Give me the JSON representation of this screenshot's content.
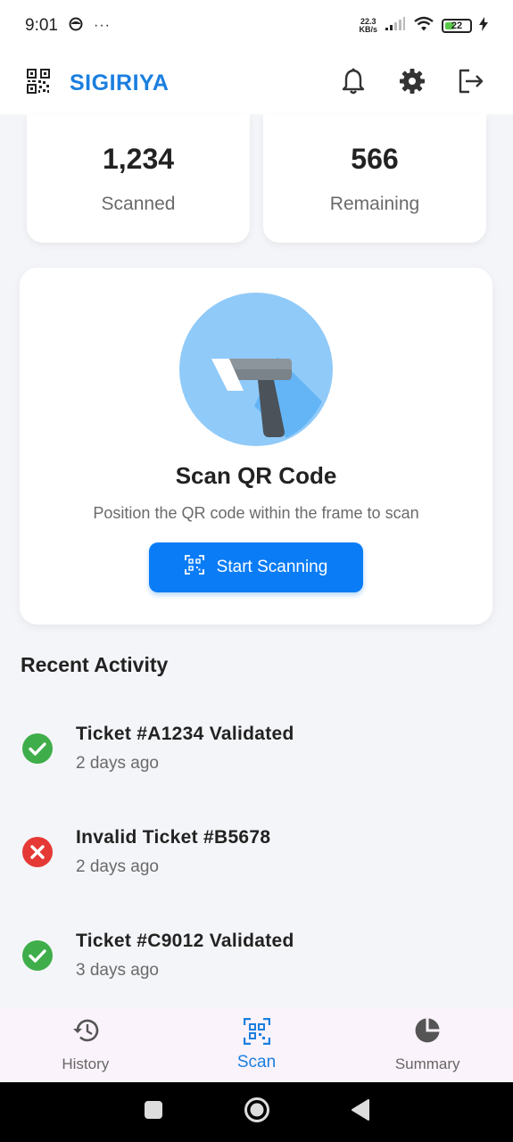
{
  "status_bar": {
    "time": "9:01",
    "more": "···",
    "net_speed_value": "22.3",
    "net_speed_unit": "KB/s",
    "battery": "22"
  },
  "app_bar": {
    "title": "SIGIRIYA",
    "logo_icon": "qr-code-icon",
    "actions": [
      "bell-icon",
      "gear-icon",
      "logout-icon"
    ]
  },
  "stats": {
    "scanned_value": "1,234",
    "scanned_label": "Scanned",
    "remaining_value": "566",
    "remaining_label": "Remaining"
  },
  "scan_card": {
    "illustration_icon": "barcode-scanner-icon",
    "title": "Scan QR Code",
    "subtitle": "Position the QR code within the frame to scan",
    "button_label": "Start Scanning",
    "button_icon": "qr-scan-icon"
  },
  "recent_activity": {
    "title": "Recent Activity",
    "items": [
      {
        "title": "Ticket #A1234 Validated",
        "time": "2 days ago",
        "status": "valid",
        "icon": "check-circle-icon"
      },
      {
        "title": "Invalid Ticket #B5678",
        "time": "2 days ago",
        "status": "invalid",
        "icon": "error-circle-icon"
      },
      {
        "title": "Ticket #C9012 Validated",
        "time": "3 days ago",
        "status": "valid",
        "icon": "check-circle-icon"
      }
    ]
  },
  "bottom_nav": {
    "items": [
      {
        "label": "History",
        "icon": "history-icon",
        "active": false
      },
      {
        "label": "Scan",
        "icon": "qr-scan-icon",
        "active": true
      },
      {
        "label": "Summary",
        "icon": "pie-chart-icon",
        "active": false
      }
    ]
  },
  "colors": {
    "accent": "#1a7fe0",
    "button": "#0a7cf5",
    "success": "#3fae4a",
    "error": "#e53935",
    "background": "#f4f5f8"
  }
}
